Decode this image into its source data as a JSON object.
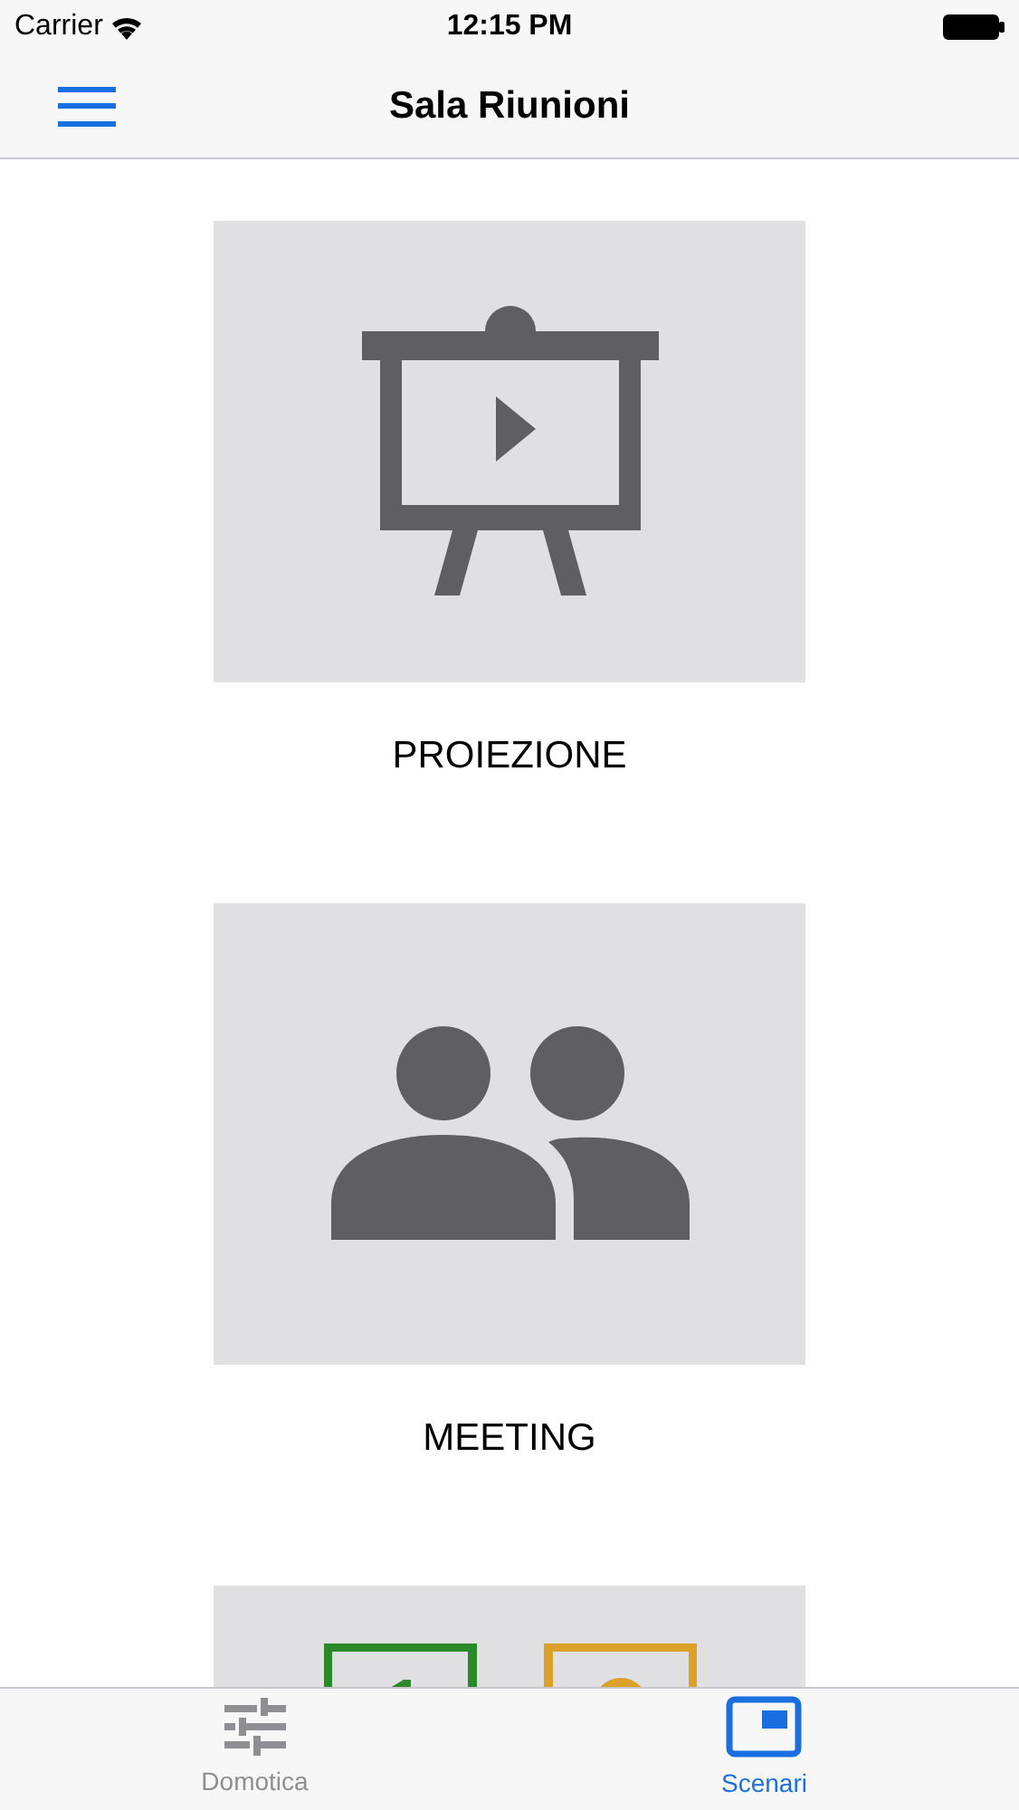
{
  "status_bar": {
    "carrier": "Carrier",
    "time": "12:15 PM"
  },
  "nav_bar": {
    "title": "Sala Riunioni"
  },
  "scenes": [
    {
      "kind": "scene",
      "label": "PROIEZIONE"
    },
    {
      "kind": "scene",
      "label": "MEETING"
    },
    {
      "kind": "scene"
    }
  ],
  "tab_bar": [
    {
      "label": "Domotica",
      "selected": false
    },
    {
      "label": "Scenari",
      "selected": true
    }
  ]
}
